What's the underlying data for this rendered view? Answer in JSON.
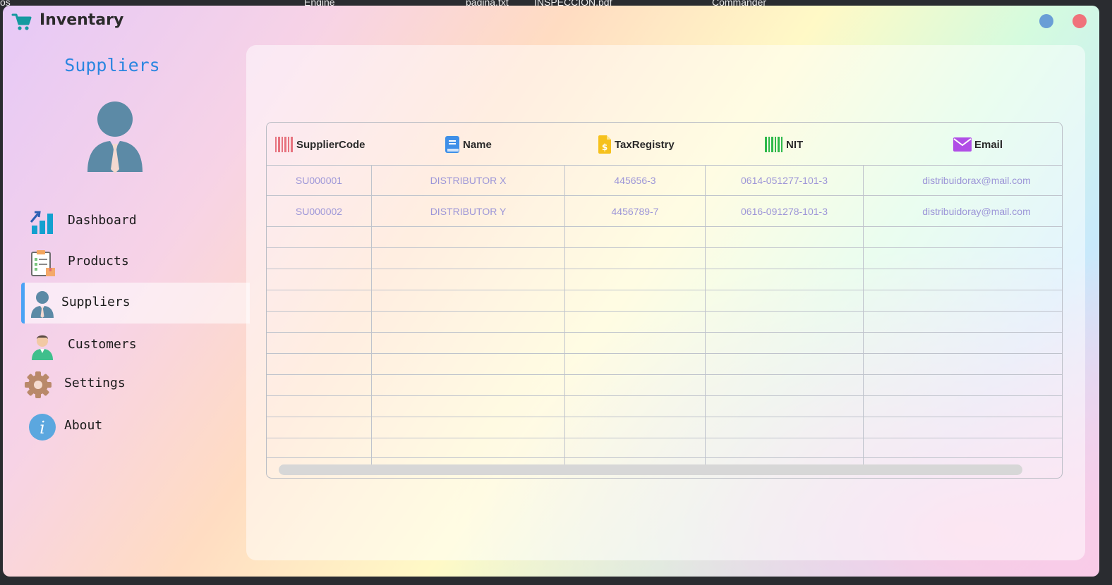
{
  "desktop": {
    "labels": [
      "os",
      "Engine",
      "pagina.txt",
      "INSPECCION.pdf",
      "Commander"
    ]
  },
  "window": {
    "title": "Inventary",
    "icon": "shopping-cart-icon",
    "controls": {
      "minimize_color": "#6a9ed6",
      "close_color": "#f0727b"
    }
  },
  "sidebar": {
    "title": "Suppliers",
    "avatar_icon": "supplier-avatar-icon",
    "items": [
      {
        "label": "Dashboard",
        "icon": "bar-chart-icon",
        "active": false
      },
      {
        "label": "Products",
        "icon": "clipboard-icon",
        "active": false
      },
      {
        "label": "Suppliers",
        "icon": "supplier-icon",
        "active": true
      },
      {
        "label": "Customers",
        "icon": "customer-icon",
        "active": false
      },
      {
        "label": "Settings",
        "icon": "gear-icon",
        "active": false
      },
      {
        "label": "About",
        "icon": "info-icon",
        "active": false
      }
    ],
    "accent_color": "#4aa3f5"
  },
  "table": {
    "columns": [
      {
        "label": "SupplierCode",
        "icon": "barcode-icon"
      },
      {
        "label": "Name",
        "icon": "book-icon"
      },
      {
        "label": "TaxRegistry",
        "icon": "dollar-document-icon"
      },
      {
        "label": "NIT",
        "icon": "barcode-icon"
      },
      {
        "label": "Email",
        "icon": "envelope-icon"
      }
    ],
    "rows": [
      [
        "SU000001",
        "DISTRIBUTOR X",
        "445656-3",
        "0614-051277-101-3",
        "distribuidorax@mail.com"
      ],
      [
        "SU000002",
        "DISTRIBUTOR Y",
        "4456789-7",
        "0616-091278-101-3",
        "distribuidoray@mail.com"
      ]
    ],
    "empty_rows": 11,
    "cell_text_color": "#9d96d8"
  }
}
